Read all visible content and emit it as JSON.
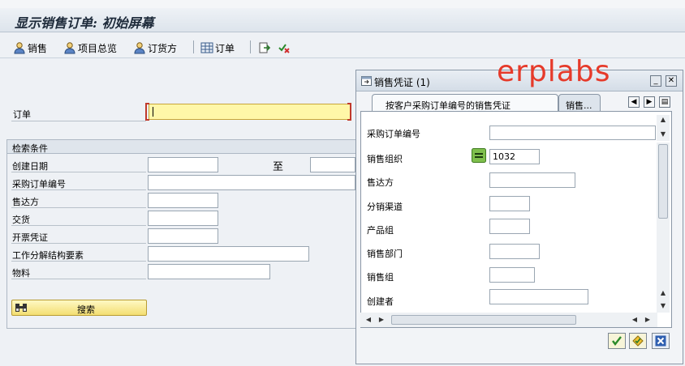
{
  "window": {
    "title": "显示销售订单: 初始屏幕"
  },
  "toolbar": {
    "sales": "销售",
    "item_overview": "项目总览",
    "sold_to": "订货方",
    "order": "订单"
  },
  "order_label": "订单",
  "order_value": "",
  "search": {
    "header": "检索条件",
    "to_label": "至",
    "fields": [
      {
        "label": "创建日期",
        "value": ""
      },
      {
        "label": "采购订单编号",
        "value": ""
      },
      {
        "label": "售达方",
        "value": ""
      },
      {
        "label": "交货",
        "value": ""
      },
      {
        "label": "开票凭证",
        "value": ""
      },
      {
        "label": "工作分解结构要素",
        "value": ""
      },
      {
        "label": "物料",
        "value": ""
      }
    ],
    "search_button": "搜索"
  },
  "watermark": "erplabs",
  "popup": {
    "title": "销售凭证 (1)",
    "tab_active": "按客户采购订单编号的销售凭证",
    "tab_other": "销售...",
    "fields": [
      {
        "label": "采购订单编号",
        "value": ""
      },
      {
        "label": "销售组织",
        "value": "1032"
      },
      {
        "label": "售达方",
        "value": ""
      },
      {
        "label": "分销渠道",
        "value": ""
      },
      {
        "label": "产品组",
        "value": ""
      },
      {
        "label": "销售部门",
        "value": ""
      },
      {
        "label": "销售组",
        "value": ""
      },
      {
        "label": "创建者",
        "value": ""
      }
    ]
  },
  "colors": {
    "accent": "#e63a2a",
    "required_field": "#fff7a8",
    "button_yellow": "#f3de72"
  }
}
